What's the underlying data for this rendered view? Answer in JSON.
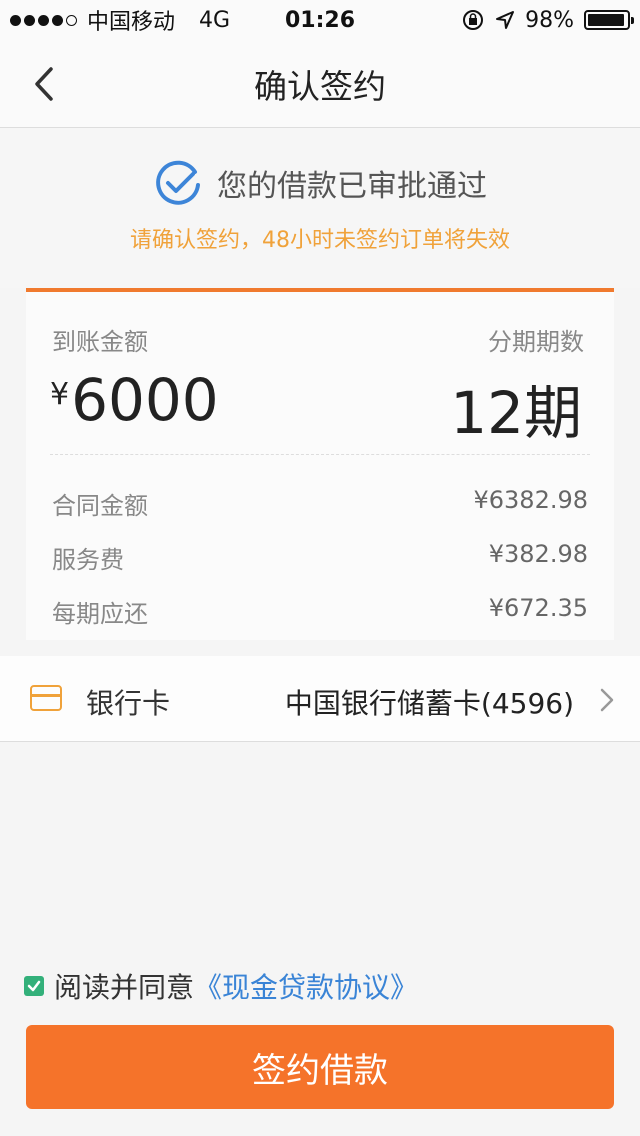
{
  "status_bar": {
    "carrier": "中国移动",
    "network": "4G",
    "time": "01:26",
    "battery": "98%",
    "battery_level": 0.98,
    "signal_strength": 4
  },
  "nav": {
    "title": "确认签约"
  },
  "approval": {
    "title": "您的借款已审批通过",
    "note": "请确认签约，48小时未签约订单将失效"
  },
  "summary": {
    "amount_label": "到账金额",
    "amount_currency": "¥",
    "amount_value": "6000",
    "periods_label": "分期期数",
    "periods_value": "12期",
    "rows": [
      {
        "label": "合同金额",
        "value": "¥6382.98"
      },
      {
        "label": "服务费",
        "value": "¥382.98"
      },
      {
        "label": "每期应还",
        "value": "¥672.35"
      }
    ]
  },
  "bank": {
    "label": "银行卡",
    "value": "中国银行储蓄卡(4596)"
  },
  "agreement": {
    "text": "阅读并同意",
    "link": "《现金贷款协议》",
    "checked": true
  },
  "submit": {
    "label": "签约借款"
  },
  "colors": {
    "accent": "#f5732a",
    "note": "#f0a23a",
    "link": "#3a84d6",
    "check": "#33b07a",
    "approval_icon": "#3d85d8"
  }
}
